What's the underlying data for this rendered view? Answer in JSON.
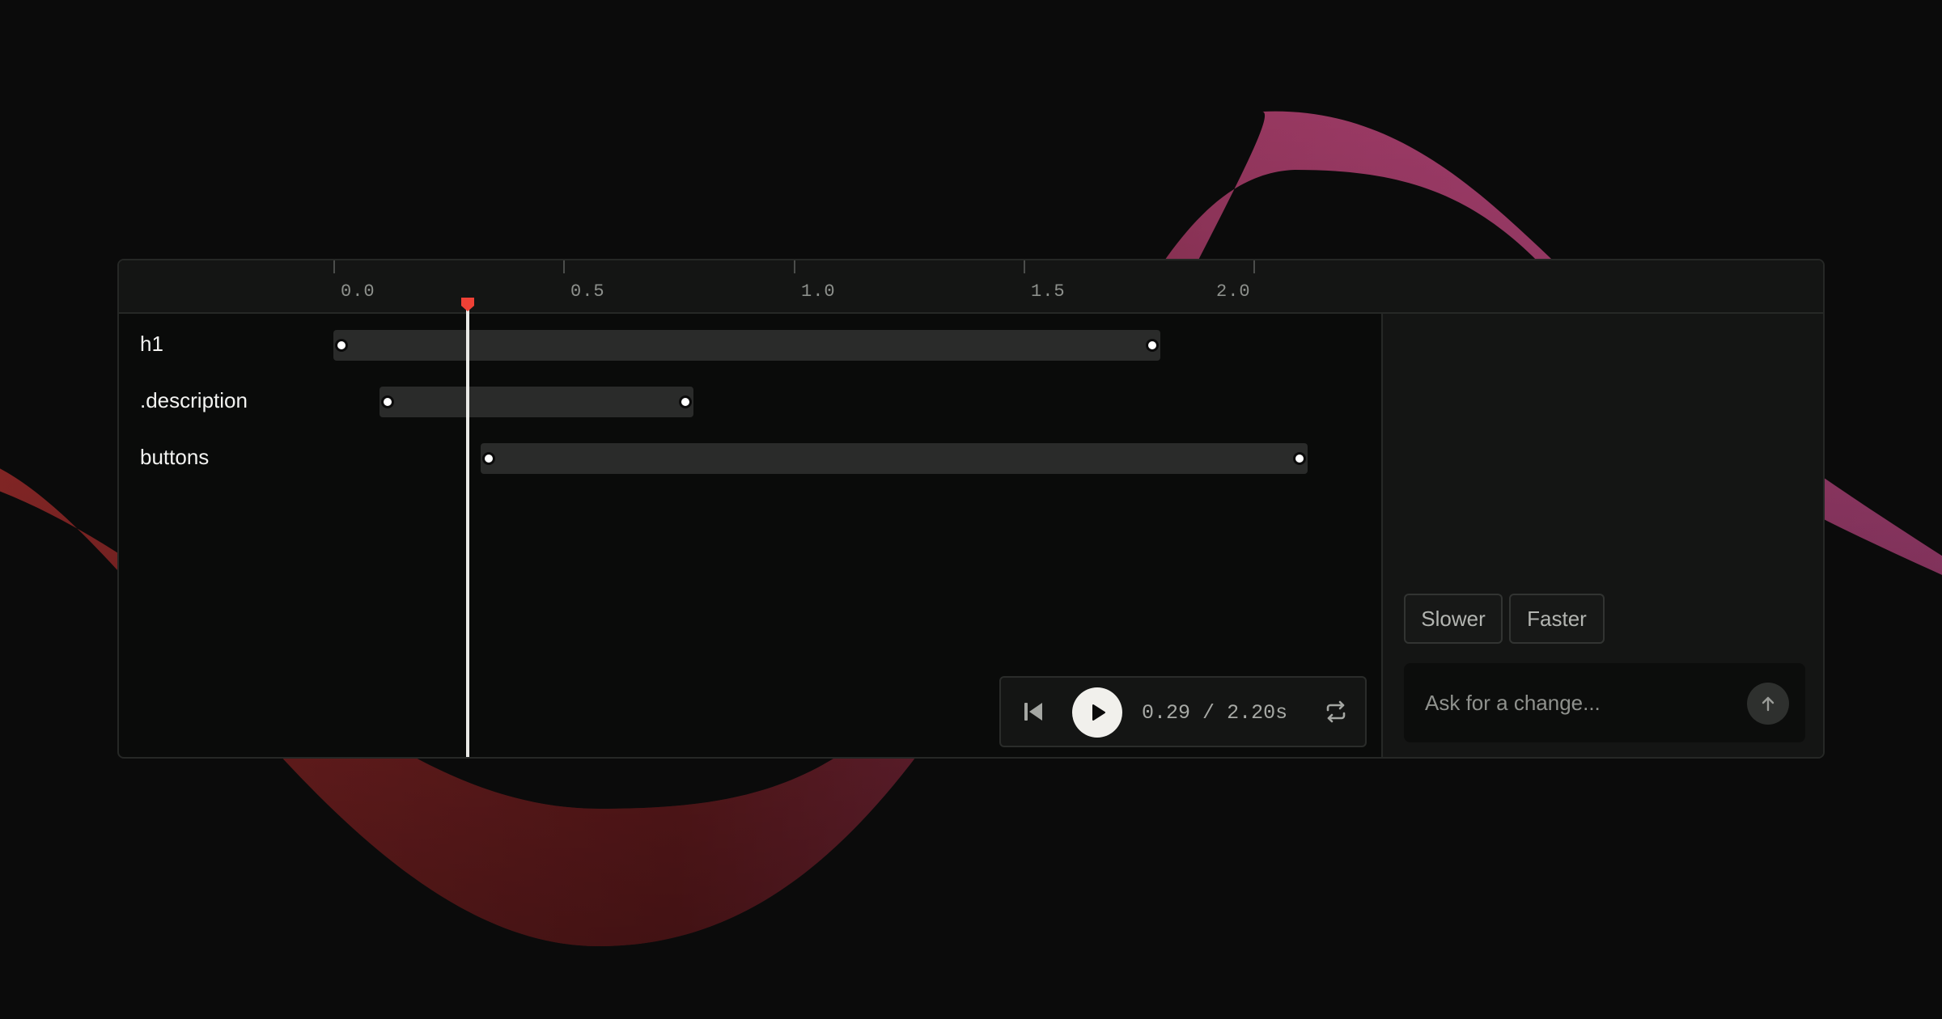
{
  "ruler": {
    "ticks": [
      "0.0",
      "0.5",
      "1.0",
      "1.5",
      "2.0"
    ]
  },
  "tracks": [
    {
      "label": "h1",
      "start": 0.0,
      "end": 1.8
    },
    {
      "label": ".description",
      "start": 0.1,
      "end": 0.78
    },
    {
      "label": "buttons",
      "start": 0.32,
      "end": 2.12
    }
  ],
  "playhead": {
    "time": 0.29
  },
  "player": {
    "current": "0.29",
    "separator": "/",
    "total": "2.20s"
  },
  "side_panel": {
    "slower_label": "Slower",
    "faster_label": "Faster",
    "ask_placeholder": "Ask for a change..."
  },
  "colors": {
    "playhead_marker": "#ef4136",
    "wave_pink": "#b4467f",
    "wave_red": "#8e2a2a"
  }
}
